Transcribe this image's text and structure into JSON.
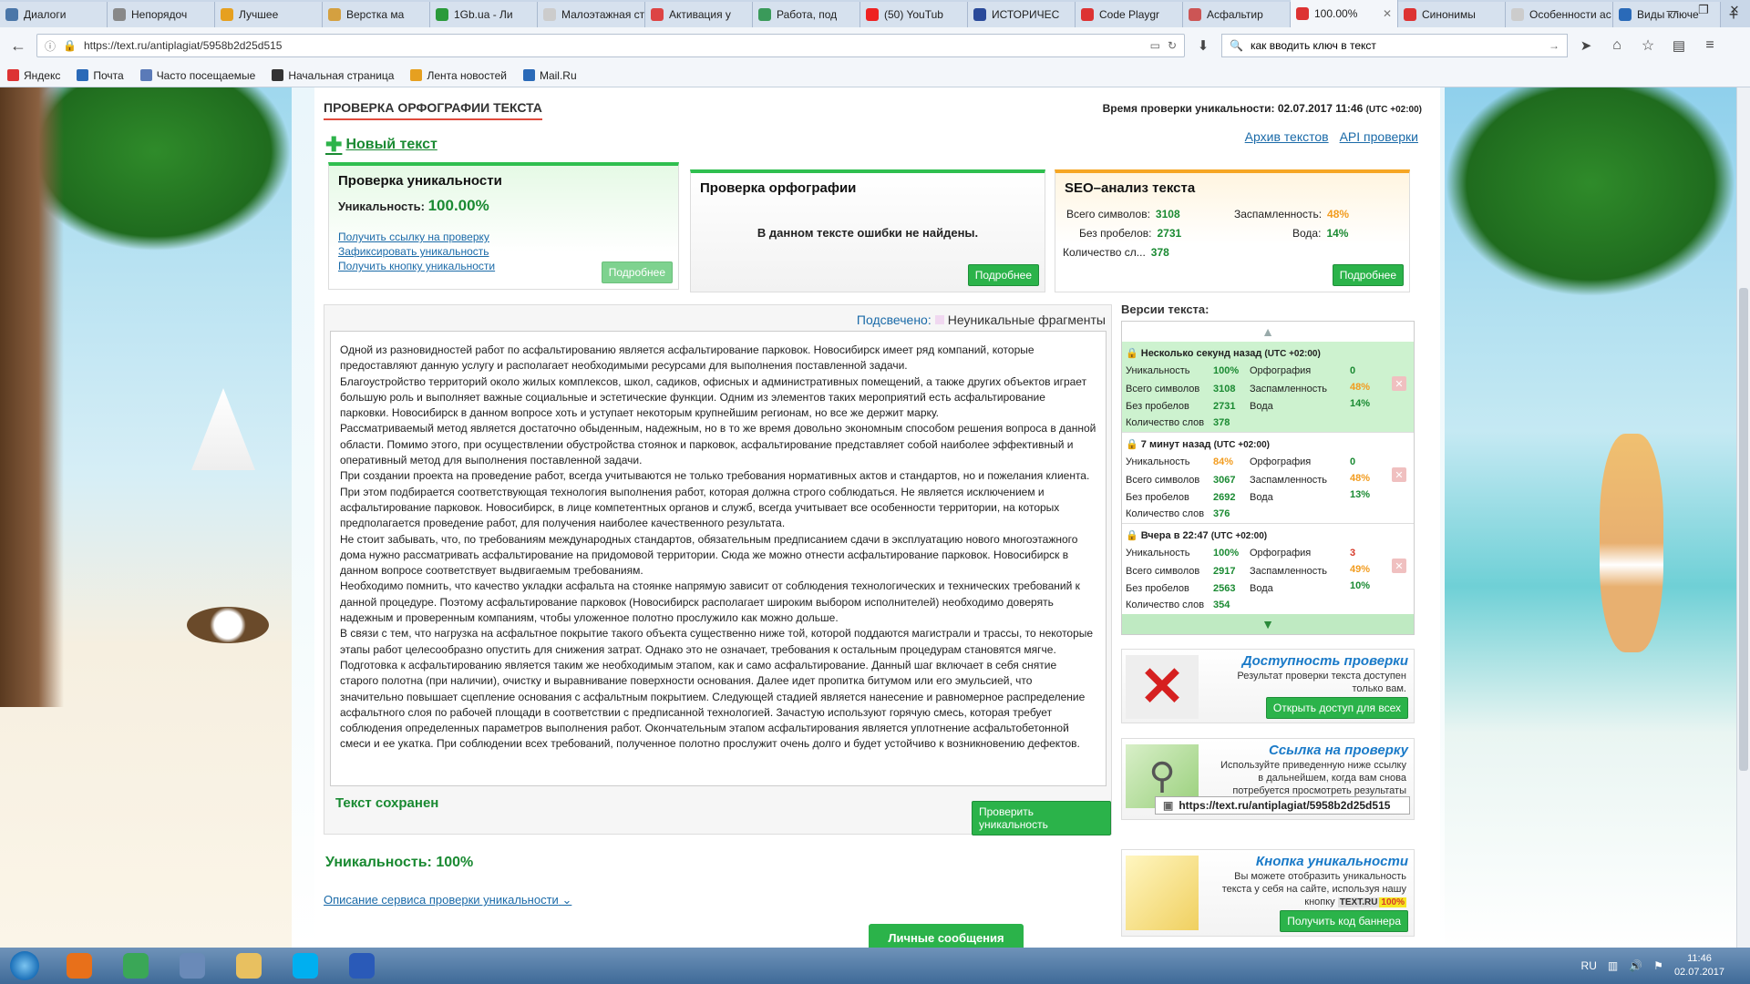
{
  "browser": {
    "tabs": [
      {
        "label": "Диалоги",
        "color": "#4a76a8"
      },
      {
        "label": "Непорядоч",
        "color": "#888888"
      },
      {
        "label": "Лучшее",
        "color": "#e6a020"
      },
      {
        "label": "Верстка ма",
        "color": "#d4a040"
      },
      {
        "label": "1Gb.ua - Ли",
        "color": "#2a9a3a"
      },
      {
        "label": "Малоэтажная ст",
        "color": "#cccccc"
      },
      {
        "label": "Активация у",
        "color": "#d44"
      },
      {
        "label": "Работа, под",
        "color": "#3a9a5a"
      },
      {
        "label": "(50) YouTub",
        "color": "#e22"
      },
      {
        "label": "ИСТОРИЧЕС",
        "color": "#2a4a9a"
      },
      {
        "label": "Code Playgr",
        "color": "#d33"
      },
      {
        "label": "Асфальтир",
        "color": "#c55"
      },
      {
        "label": "100.00%",
        "color": "#d33",
        "active": true
      },
      {
        "label": "Синонимы",
        "color": "#d33"
      },
      {
        "label": "Особенности ас",
        "color": "#cccccc"
      },
      {
        "label": "Виды ключе",
        "color": "#2a6ab8"
      }
    ],
    "url": "https://text.ru/antiplagiat/5958b2d25d515",
    "search_value": "как вводить ключ в текст",
    "bookmarks": [
      {
        "label": "Яндекс",
        "color": "#d33"
      },
      {
        "label": "Почта",
        "color": "#2a6ab8"
      },
      {
        "label": "Часто посещаемые",
        "color": "#5a7ab8"
      },
      {
        "label": "Начальная страница",
        "color": "#333333"
      },
      {
        "label": "Лента новостей",
        "color": "#e6a020"
      },
      {
        "label": "Mail.Ru",
        "color": "#2a6ab8"
      }
    ]
  },
  "header": {
    "title": "ПРОВЕРКА ОРФОГРАФИИ ТЕКСТА",
    "time_label": "Время проверки уникальности: 02.07.2017 11:46",
    "time_tz": "(UTC +02:00)",
    "new_text": "Новый текст",
    "archive_link": "Архив текстов",
    "api_link": "API проверки"
  },
  "card_uniqueness": {
    "title": "Проверка уникальности",
    "label": "Уникальность:",
    "value": "100.00%",
    "links": [
      "Получить ссылку на проверку",
      "Зафиксировать уникальность",
      "Получить кнопку уникальности"
    ],
    "button": "Подробнее"
  },
  "card_spelling": {
    "title": "Проверка орфографии",
    "message": "В данном тексте ошибки не найдены.",
    "button": "Подробнее"
  },
  "card_seo": {
    "title": "SEO–анализ текста",
    "total_chars_label": "Всего символов:",
    "total_chars": "3108",
    "no_spaces_label": "Без пробелов:",
    "no_spaces": "2731",
    "words_label": "Количество сл...",
    "words": "378",
    "spam_label": "Заспамленность:",
    "spam": "48%",
    "water_label": "Вода:",
    "water": "14%",
    "button": "Подробнее"
  },
  "editor": {
    "highlight_label": "Подсвечено:",
    "highlight_value": "Неуникальные фрагменты",
    "paragraphs": [
      "Одной из разновидностей работ по асфальтированию является асфальтирование парковок. Новосибирск имеет ряд компаний, которые предоставляют данную услугу и располагает необходимыми ресурсами для выполнения поставленной задачи.",
      "Благоустройство территорий около жилых комплексов, школ, садиков, офисных и административных помещений, а также других объектов играет большую роль и выполняет важные социальные и эстетические функции. Одним из элементов таких мероприятий есть асфальтирование парковки. Новосибирск в данном вопросе хоть и уступает некоторым крупнейшим регионам, но все же держит марку.",
      "Рассматриваемый метод является достаточно обыденным, надежным, но в то же время довольно экономным способом решения вопроса в данной области. Помимо этого, при осуществлении обустройства стоянок и парковок, асфальтирование представляет собой наиболее эффективный и оперативный метод для выполнения поставленной задачи.",
      "При создании проекта на проведение работ, всегда учитываются не только требования нормативных актов и стандартов, но и пожелания клиента. При этом подбирается соответствующая технология выполнения работ, которая должна строго соблюдаться. Не является исключением и асфальтирование парковок. Новосибирск, в лице компетентных органов и служб, всегда учитывает все особенности территории, на которых предполагается проведение работ, для получения наиболее качественного результата.",
      "Не стоит забывать, что, по требованиям международных стандартов, обязательным предписанием сдачи в эксплуатацию нового многоэтажного дома нужно рассматривать асфальтирование на придомовой территории. Сюда же можно отнести асфальтирование парковок. Новосибирск в данном вопросе соответствует выдвигаемым требованиям.",
      "Необходимо помнить, что качество укладки асфальта на стоянке напрямую зависит от соблюдения технологических и технических требований к данной процедуре. Поэтому асфальтирование парковок (Новосибирск располагает широким выбором исполнителей) необходимо доверять надежным и проверенным компаниям, чтобы уложенное полотно прослужило как можно дольше.",
      "В связи с тем, что нагрузка на асфальтное покрытие такого объекта существенно ниже той, которой поддаются магистрали и трассы, то некоторые этапы работ целесообразно опустить для снижения затрат. Однако это не означает, требования к остальным процедурам становятся мягче.",
      "Подготовка к асфальтированию является таким же необходимым этапом, как и само асфальтирование. Данный шаг включает в себя снятие старого полотна (при наличии), очистку и выравнивание поверхности основания. Далее идет пропитка битумом или его эмульсией, что значительно повышает сцепление основания с асфальтным покрытием. Следующей стадией является нанесение и равномерное распределение асфальтного слоя по рабочей площади в соответствии с предписанной технологией. Зачастую используют горячую смесь, которая требует соблюдения определенных параметров выполнения работ. Окончательным этапом асфальтирования является уплотнение асфальтобетонной смеси и ее укатка. При соблюдении всех требований, полученное полотно прослужит очень долго и будет устойчиво к возникновению дефектов."
    ],
    "saved_label": "Текст сохранен",
    "check_button": "Проверить уникальность"
  },
  "bottom": {
    "uniqueness": "Уникальность: 100%",
    "description_link": "Описание сервиса проверки уникальности",
    "messages_button": "Личные сообщения"
  },
  "versions": {
    "title": "Версии текста:",
    "items": [
      {
        "time": "Несколько секунд назад",
        "tz": "(UTC +02:00)",
        "uniq": "100%",
        "spelling": "0",
        "total": "3108",
        "spam": "48%",
        "nospace": "2731",
        "water": "14%",
        "words": "378",
        "uniq_color": "green",
        "spell_color": "green"
      },
      {
        "time": "7 минут назад",
        "tz": "(UTC +02:00)",
        "uniq": "84%",
        "spelling": "0",
        "total": "3067",
        "spam": "48%",
        "nospace": "2692",
        "water": "13%",
        "words": "376",
        "uniq_color": "org",
        "spell_color": "green"
      },
      {
        "time": "Вчера в 22:47",
        "tz": "(UTC +02:00)",
        "uniq": "100%",
        "spelling": "3",
        "total": "2917",
        "spam": "49%",
        "nospace": "2563",
        "water": "10%",
        "words": "354",
        "uniq_color": "green",
        "spell_color": "red"
      }
    ],
    "labels": {
      "uniq": "Уникальность",
      "spelling": "Орфография",
      "total": "Всего символов",
      "spam": "Заспамленность",
      "nospace": "Без пробелов",
      "water": "Вода",
      "words": "Количество слов"
    }
  },
  "promos": [
    {
      "title": "Доступность проверки",
      "desc": "Результат проверки текста доступен только вам.",
      "button": "Открыть доступ для всех"
    },
    {
      "title": "Ссылка на проверку",
      "desc": "Используйте приведенную ниже ссылку в дальнейшем, когда вам снова потребуется просмотреть результаты данной проверки.",
      "link": "https://text.ru/antiplagiat/5958b2d25d515"
    },
    {
      "title": "Кнопка уникальности",
      "desc": "Вы можете отобразить уникальность текста у себя на сайте, используя нашу кнопку",
      "badge_site": "TEXT.RU",
      "badge_value": "100%",
      "button": "Получить код баннера"
    }
  ],
  "taskbar": {
    "lang": "RU",
    "time": "11:46",
    "date": "02.07.2017",
    "apps": [
      {
        "name": "firefox",
        "color": "#e8701a"
      },
      {
        "name": "chrome",
        "color": "#3aa757"
      },
      {
        "name": "network",
        "color": "#6a8ab8"
      },
      {
        "name": "explorer",
        "color": "#e8c060"
      },
      {
        "name": "skype",
        "color": "#00aff0"
      },
      {
        "name": "word",
        "color": "#2a5ab8"
      }
    ]
  }
}
